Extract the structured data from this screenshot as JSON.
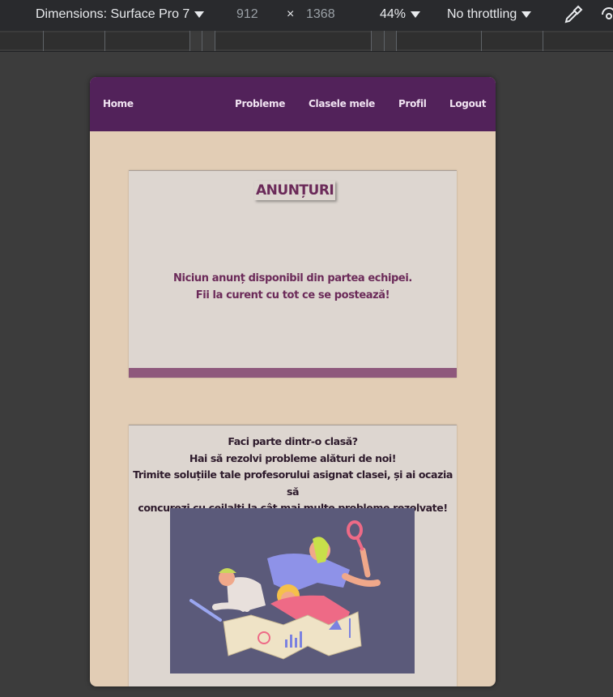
{
  "devtools": {
    "dimensions_label": "Dimensions: Surface Pro 7",
    "width": "912",
    "times": "×",
    "height": "1368",
    "zoom": "44%",
    "throttling": "No throttling"
  },
  "nav": {
    "home": "Home",
    "problems": "Probleme",
    "classes": "Clasele mele",
    "profile": "Profil",
    "logout": "Logout"
  },
  "announcements": {
    "title": "ANUNȚURI",
    "line1": "Niciun anunț disponibil din partea echipei.",
    "line2": "Fii la curent cu tot ce se postează!"
  },
  "class_card": {
    "line1": "Faci parte dintr-o clasă?",
    "line2": "Hai să rezolvi probleme alături de noi!",
    "line3": "Trimite soluțiile tale profesorului asignat clasei, și ai ocazia să",
    "line4": "concurezi cu ceilalți la cât mai multe probleme rezolvate!"
  },
  "colors": {
    "navbar": "#52225a",
    "page_bg": "#e2cdb5",
    "card_bg": "#ddd6d0",
    "accent": "#6b2a59",
    "card_bar": "#8e587c"
  }
}
